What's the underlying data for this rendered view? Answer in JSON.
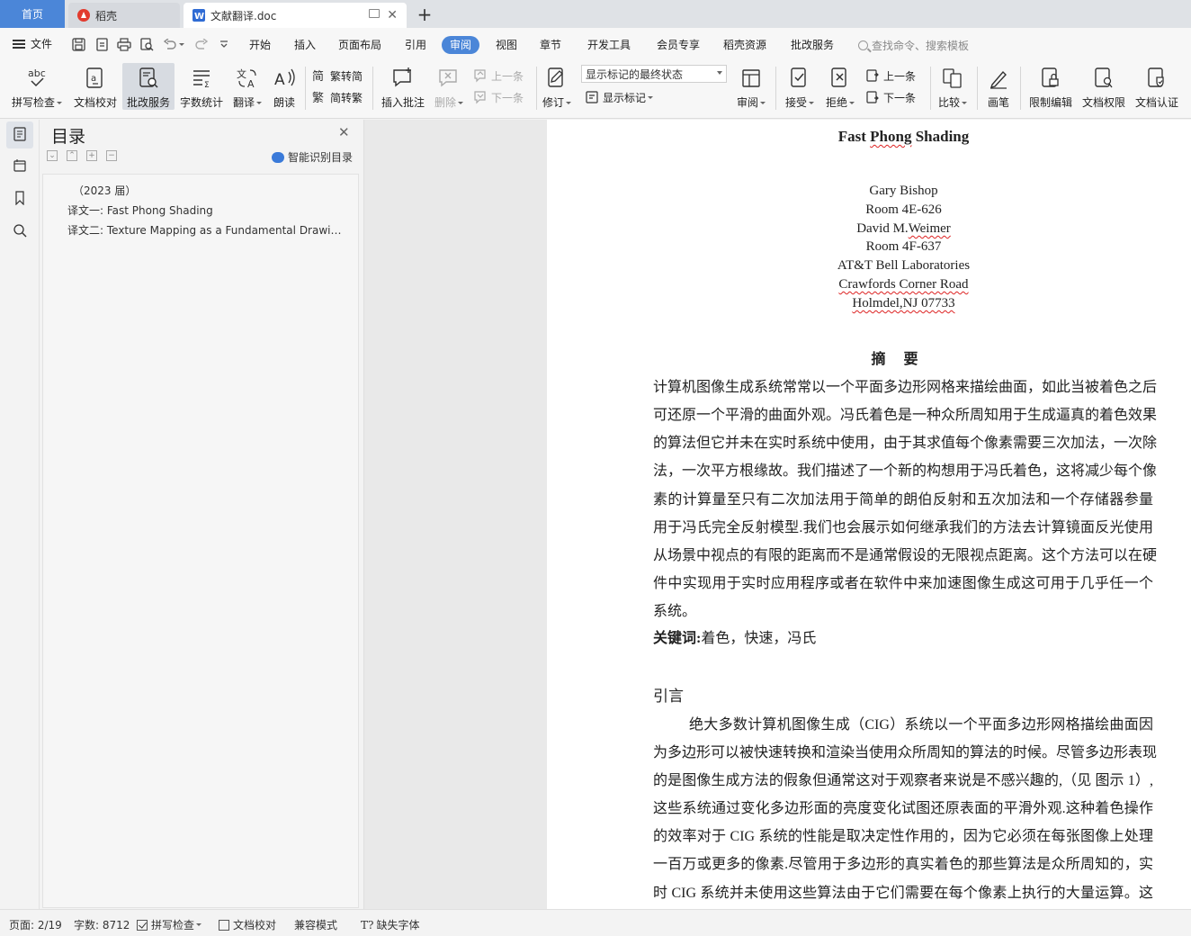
{
  "tabs": {
    "home": "首页",
    "daoke": "稻壳",
    "document": "文献翻译.doc",
    "add": "+"
  },
  "menu": {
    "file": "文件",
    "items": [
      "开始",
      "插入",
      "页面布局",
      "引用",
      "审阅",
      "视图",
      "章节",
      "开发工具",
      "会员专享",
      "稻壳资源",
      "批改服务"
    ],
    "active": "审阅",
    "search": "查找命令、搜索模板"
  },
  "ribbon": {
    "spell_check": "拼写检查",
    "doc_proof": "文档校对",
    "review_service": "批改服务",
    "word_count": "字数统计",
    "translate": "翻译",
    "read_aloud": "朗读",
    "trad_to_simp": "繁转简",
    "simp_to_trad": "简转繁",
    "insert_comment": "插入批注",
    "delete": "删除",
    "prev_comment": "上一条",
    "next_comment": "下一条",
    "track_changes": "修订",
    "markup_state": "显示标记的最终状态",
    "show_markup": "显示标记",
    "review_pane": "审阅",
    "accept": "接受",
    "reject": "拒绝",
    "prev_change": "上一条",
    "next_change": "下一条",
    "compare": "比较",
    "pen": "画笔",
    "restrict_edit": "限制编辑",
    "doc_permission": "文档权限",
    "doc_certify": "文档认证"
  },
  "toc": {
    "title": "目录",
    "smart": "智能识别目录",
    "items": [
      "（2023 届）",
      "译文一: Fast Phong Shading",
      "译文二: Texture Mapping as a Fundamental Drawing Primitive"
    ]
  },
  "document": {
    "title": "Fast Phong Shading",
    "authors": [
      "Gary Bishop",
      "Room 4E-626",
      "David M.Weimer",
      "Room 4F-637",
      "AT&T Bell Laboratories",
      "Crawfords Corner Road",
      "Holmdel,NJ 07733"
    ],
    "abstract_heading": "摘要",
    "abstract_lines": [
      "计算机图像生成系统常常以一个平面多边形网格来描绘曲面，如此当被着色之后",
      "可还原一个平滑的曲面外观。冯氏着色是一种众所周知用于生成逼真的着色效果",
      "的算法但它并未在实时系统中使用，由于其求值每个像素需要三次加法，一次除",
      "法，一次平方根缘故。我们描述了一个新的构想用于冯氏着色，这将减少每个像",
      "素的计算量至只有二次加法用于简单的朗伯反射和五次加法和一个存储器参量",
      "用于冯氏完全反射模型.我们也会展示如何继承我们的方法去计算镜面反光使用",
      "从场景中视点的有限的距离而不是通常假设的无限视点距离。这个方法可以在硬",
      "件中实现用于实时应用程序或者在软件中来加速图像生成这可用于几乎任一个",
      "系统。"
    ],
    "keywords_label": "关键词:",
    "keywords": "着色，快速，冯氏",
    "intro_heading": "引言",
    "intro_lines": [
      "绝大多数计算机图像生成（CIG）系统以一个平面多边形网格描绘曲面因",
      "为多边形可以被快速转换和渲染当使用众所周知的算法的时候。尽管多边形表现",
      "的是图像生成方法的假象但通常这对于观察者来说是不感兴趣的,（见  图示 1）,",
      "这些系统通过变化多边形面的亮度变化试图还原表面的平滑外观.这种着色操作",
      "的效率对于 CIG 系统的性能是取决定性作用的，因为它必须在每张图像上处理",
      "一百万或更多的像素.尽管用于多边形的真实着色的那些算法是众所周知的，实",
      "时 CIG 系统并未使用这些算法由于它们需要在每个像素上执行的大量运算。这"
    ]
  },
  "status": {
    "page": "页面: 2/19",
    "words": "字数: 8712",
    "spell_check": "拼写检查",
    "doc_proof": "文档校对",
    "compat_mode": "兼容模式",
    "missing_font": "缺失字体"
  },
  "colors": {
    "accent": "#4b86d8",
    "wps_red": "#e23b2e",
    "spell_underline": "#dd2222"
  }
}
